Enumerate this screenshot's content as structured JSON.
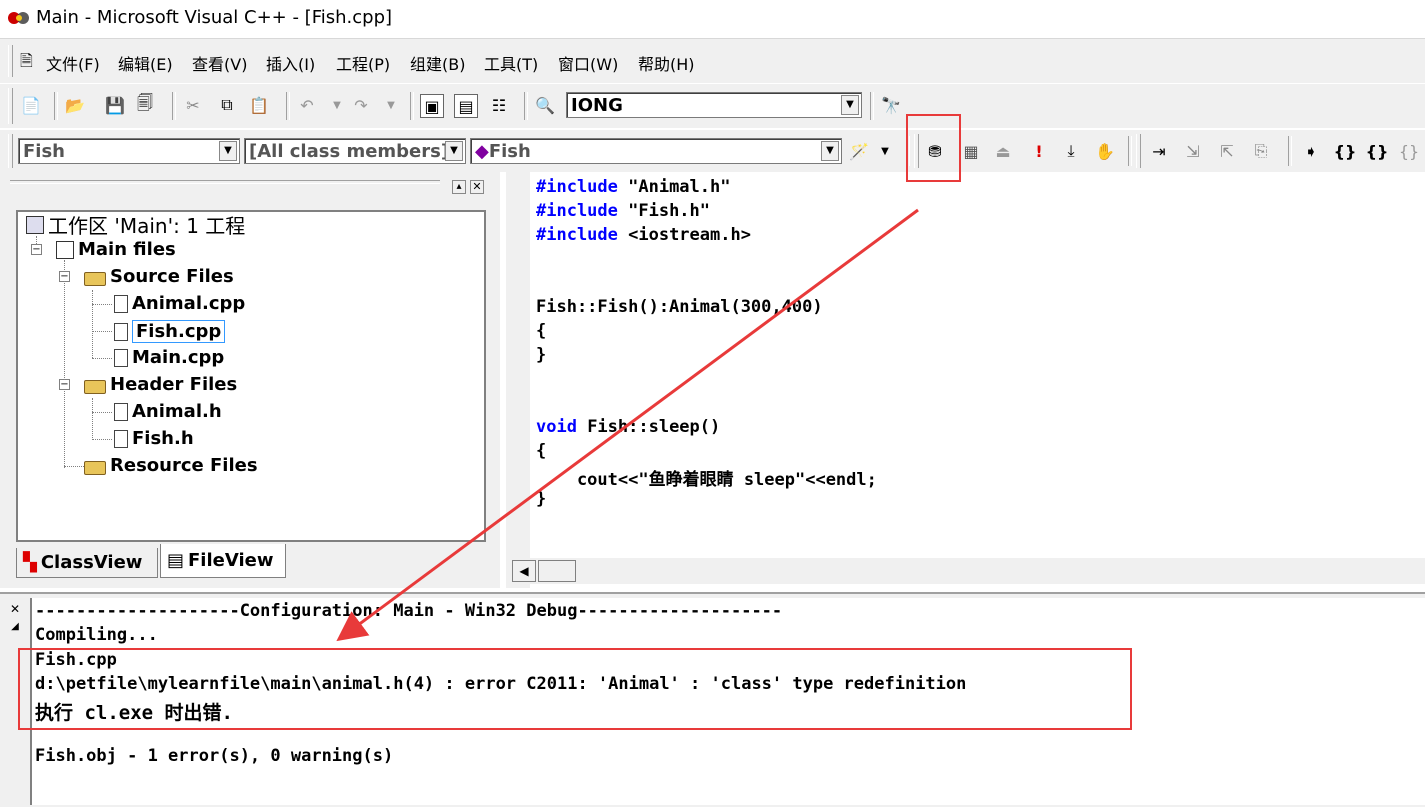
{
  "window": {
    "title": "Main - Microsoft Visual C++ - [Fish.cpp]"
  },
  "menu": {
    "items": [
      "文件(F)",
      "编辑(E)",
      "查看(V)",
      "插入(I)",
      "工程(P)",
      "组建(B)",
      "工具(T)",
      "窗口(W)",
      "帮助(H)"
    ]
  },
  "toolbar": {
    "find_combo_value": "IONG",
    "class_combo_value": "Fish",
    "members_combo_value": "[All class members]",
    "function_combo_value": "Fish"
  },
  "workspace": {
    "root_label": "工作区 'Main': 1 工程",
    "project_label": "Main files",
    "source_folder": "Source Files",
    "source_files": [
      "Animal.cpp",
      "Fish.cpp",
      "Main.cpp"
    ],
    "header_folder": "Header Files",
    "header_files": [
      "Animal.h",
      "Fish.h"
    ],
    "resource_folder": "Resource Files",
    "tabs": [
      "ClassView",
      "FileView"
    ],
    "selected_file": "Fish.cpp"
  },
  "editor": {
    "lines": [
      {
        "kw": "#include",
        "rest": " \"Animal.h\""
      },
      {
        "kw": "#include",
        "rest": " \"Fish.h\""
      },
      {
        "kw": "#include",
        "rest": " <iostream.h>"
      },
      {
        "kw": "",
        "rest": "Fish::Fish():Animal(300,400)"
      },
      {
        "kw": "",
        "rest": "{"
      },
      {
        "kw": "",
        "rest": "}"
      },
      {
        "kw": "void",
        "rest": " Fish::sleep()"
      },
      {
        "kw": "",
        "rest": "{"
      },
      {
        "kw": "",
        "rest": "    cout<<\"鱼睁着眼睛 sleep\"<<endl;"
      },
      {
        "kw": "",
        "rest": "}"
      }
    ]
  },
  "output": {
    "lines": [
      "--------------------Configuration: Main - Win32 Debug--------------------",
      "Compiling...",
      "Fish.cpp",
      "d:\\petfile\\mylearnfile\\main\\animal.h(4) : error C2011: 'Animal' : 'class' type redefinition",
      "执行 cl.exe 时出错.",
      "Fish.obj - 1 error(s), 0 warning(s)"
    ]
  },
  "colors": {
    "annotation_red": "#e83a3a",
    "keyword_blue": "#0000ff",
    "chrome_gray": "#f0f0f0"
  }
}
